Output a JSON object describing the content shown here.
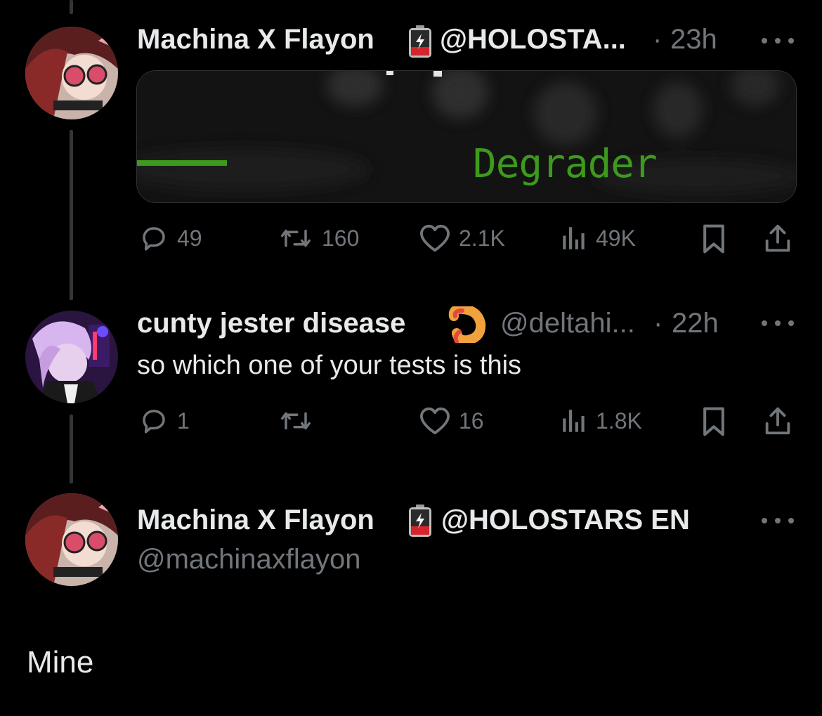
{
  "tweets": [
    {
      "display_name": "Machina X Flayon",
      "affiliation": "@HOLOSTA...",
      "separator": "·",
      "time": "23h",
      "media_text": "Degrader",
      "actions": {
        "replies": "49",
        "reposts": "160",
        "likes": "2.1K",
        "views": "49K"
      }
    },
    {
      "display_name": "cunty jester disease",
      "handle": "@deltahi...",
      "separator": "·",
      "time": "22h",
      "text": "so which one of your tests is this",
      "actions": {
        "replies": "1",
        "reposts": "",
        "likes": "16",
        "views": "1.8K"
      }
    }
  ],
  "focused": {
    "display_name": "Machina X Flayon",
    "affiliation": "@HOLOSTARS EN",
    "handle": "@machinaxflayon",
    "text": "Mine"
  },
  "colors": {
    "background": "#000000",
    "text": "#e7e9ea",
    "muted": "#71767b",
    "media_green": "#3d9a1c"
  },
  "icons": [
    "reply-icon",
    "repost-icon",
    "like-icon",
    "views-icon",
    "bookmark-icon",
    "share-icon",
    "more-icon",
    "battery-badge-icon",
    "shrimp-emoji"
  ]
}
